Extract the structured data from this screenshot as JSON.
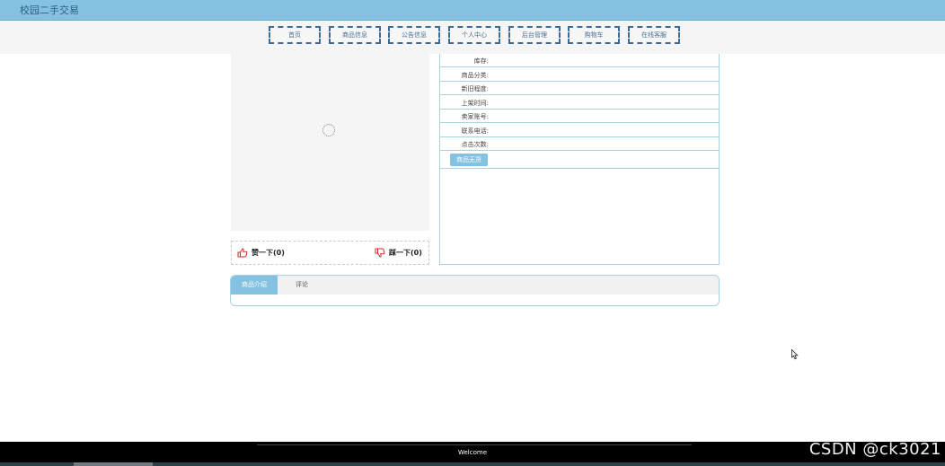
{
  "header": {
    "site_title": "校园二手交易"
  },
  "nav": {
    "items": [
      {
        "label": "首页"
      },
      {
        "label": "商品信息"
      },
      {
        "label": "公告信息"
      },
      {
        "label": "个人中心"
      },
      {
        "label": "后台管理"
      },
      {
        "label": "购物车"
      },
      {
        "label": "在线客服"
      }
    ]
  },
  "product": {
    "info_labels": [
      "库存:",
      "商品分类:",
      "新旧程度:",
      "上架时间:",
      "卖家账号:",
      "联系电话:",
      "点击次数:"
    ],
    "sold_out_button": "商品无货",
    "like_label": "赞一下(0)",
    "dislike_label": "踩一下(0)"
  },
  "tabs": [
    {
      "label": "商品介绍",
      "active": true
    },
    {
      "label": "评论",
      "active": false
    }
  ],
  "footer": {
    "text": "Welcome"
  },
  "watermark": "CSDN @ck3021",
  "colors": {
    "accent": "#85c1e0",
    "nav_border": "#3a6b99",
    "like_icon": "#d62b2b"
  }
}
